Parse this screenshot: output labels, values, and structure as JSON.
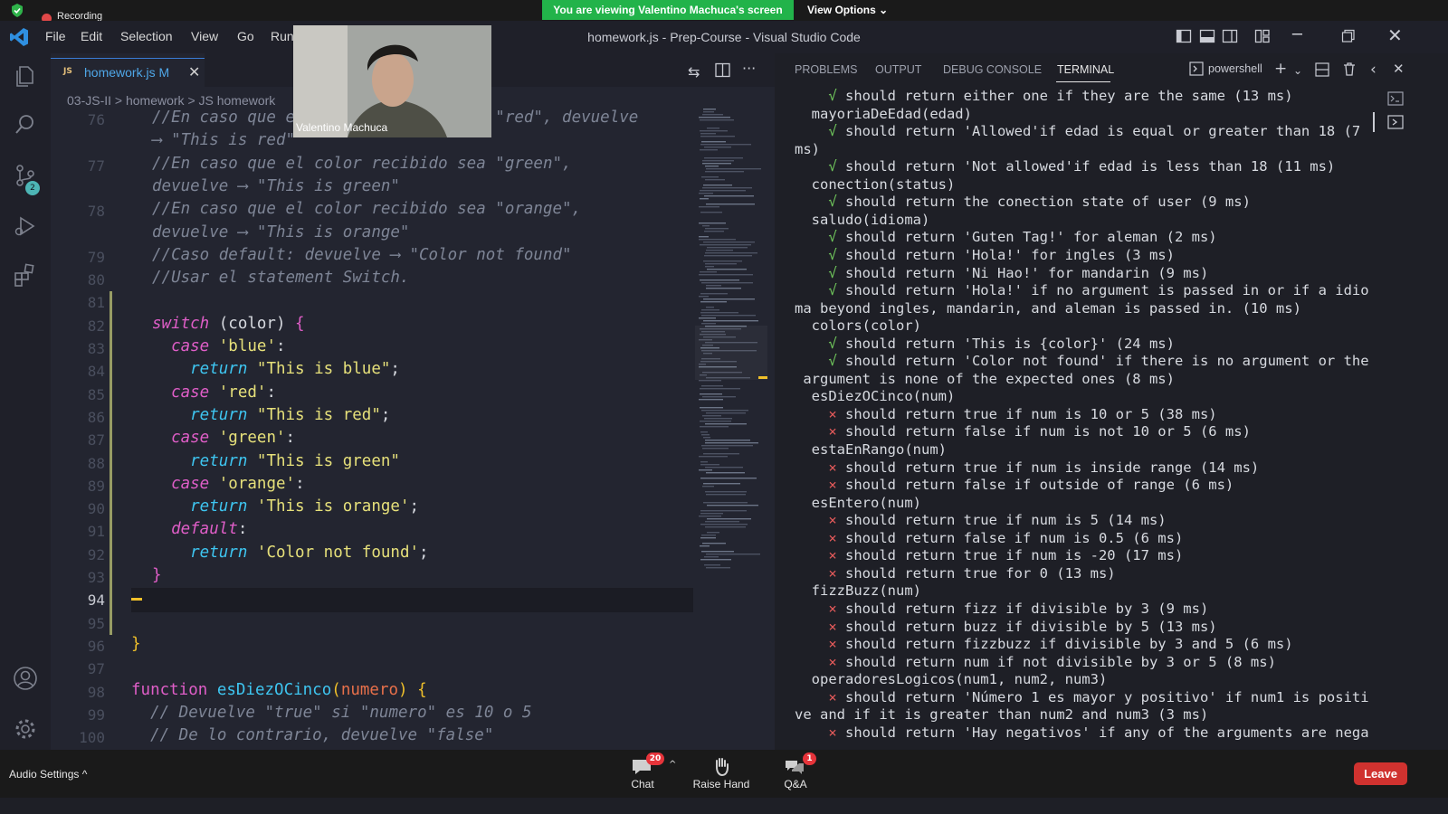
{
  "zoom": {
    "recording_label": "Recording",
    "viewing_banner": "You are viewing Valentino Machuca's screen",
    "view_options": "View Options ⌄",
    "webcam_name": "Valentino Machuca",
    "audio_settings": "Audio Settings ^",
    "chat_label": "Chat",
    "chat_badge": "20",
    "raise_hand_label": "Raise Hand",
    "qa_label": "Q&A",
    "qa_badge": "1",
    "leave_label": "Leave"
  },
  "vscode": {
    "menu": [
      "File",
      "Edit",
      "Selection",
      "View",
      "Go",
      "Run"
    ],
    "window_title": "homework.js - Prep-Course - Visual Studio Code",
    "tab_label": "homework.js M",
    "tab_file_icon": "JS",
    "breadcrumb": "03-JS-II  >  homework  >  JS  homework",
    "git_badge": "2",
    "code_lines": [
      {
        "n": "76",
        "segs": [
          {
            "t": "//En caso que el color recibido sea \"red\", devuelve",
            "c": "#7e8596",
            "i": true
          }
        ]
      },
      {
        "n": "",
        "segs": [
          {
            "t": "⟶ \"This is red\"",
            "c": "#7e8596",
            "i": true
          }
        ]
      },
      {
        "n": "77",
        "segs": [
          {
            "t": "//En caso que el color recibido sea \"green\",",
            "c": "#7e8596",
            "i": true
          }
        ]
      },
      {
        "n": "",
        "segs": [
          {
            "t": "devuelve ⟶ \"This is green\"",
            "c": "#7e8596",
            "i": true
          }
        ]
      },
      {
        "n": "78",
        "segs": [
          {
            "t": "//En caso que el color recibido sea \"orange\",",
            "c": "#7e8596",
            "i": true
          }
        ]
      },
      {
        "n": "",
        "segs": [
          {
            "t": "devuelve ⟶ \"This is orange\"",
            "c": "#7e8596",
            "i": true
          }
        ]
      },
      {
        "n": "79",
        "segs": [
          {
            "t": "//Caso default: devuelve ⟶ \"Color not found\"",
            "c": "#7e8596",
            "i": true
          }
        ]
      },
      {
        "n": "80",
        "segs": [
          {
            "t": "//Usar el statement Switch.",
            "c": "#7e8596",
            "i": true
          }
        ]
      },
      {
        "n": "81",
        "segs": []
      },
      {
        "n": "82",
        "segs": [
          {
            "t": "switch",
            "c": "#e05ec8",
            "i": true
          },
          {
            "t": " (color) ",
            "c": "#d7dae0"
          },
          {
            "t": "{",
            "c": "#e05ec8"
          }
        ]
      },
      {
        "n": "83",
        "segs": [
          {
            "t": "  case ",
            "c": "#e05ec8",
            "i": true
          },
          {
            "t": "'blue'",
            "c": "#e6e07a"
          },
          {
            "t": ":",
            "c": "#d7dae0"
          }
        ]
      },
      {
        "n": "84",
        "segs": [
          {
            "t": "    return ",
            "c": "#3ec5f0",
            "i": true
          },
          {
            "t": "\"This is blue\"",
            "c": "#e6e07a"
          },
          {
            "t": ";",
            "c": "#d7dae0"
          }
        ]
      },
      {
        "n": "85",
        "segs": [
          {
            "t": "  case ",
            "c": "#e05ec8",
            "i": true
          },
          {
            "t": "'red'",
            "c": "#e6e07a"
          },
          {
            "t": ":",
            "c": "#d7dae0"
          }
        ]
      },
      {
        "n": "86",
        "segs": [
          {
            "t": "    return ",
            "c": "#3ec5f0",
            "i": true
          },
          {
            "t": "\"This is red\"",
            "c": "#e6e07a"
          },
          {
            "t": ";",
            "c": "#d7dae0"
          }
        ]
      },
      {
        "n": "87",
        "segs": [
          {
            "t": "  case ",
            "c": "#e05ec8",
            "i": true
          },
          {
            "t": "'green'",
            "c": "#e6e07a"
          },
          {
            "t": ":",
            "c": "#d7dae0"
          }
        ]
      },
      {
        "n": "88",
        "segs": [
          {
            "t": "    return ",
            "c": "#3ec5f0",
            "i": true
          },
          {
            "t": "\"This is green\"",
            "c": "#e6e07a"
          }
        ]
      },
      {
        "n": "89",
        "segs": [
          {
            "t": "  case ",
            "c": "#e05ec8",
            "i": true
          },
          {
            "t": "'orange'",
            "c": "#e6e07a"
          },
          {
            "t": ":",
            "c": "#d7dae0"
          }
        ]
      },
      {
        "n": "90",
        "segs": [
          {
            "t": "    return ",
            "c": "#3ec5f0",
            "i": true
          },
          {
            "t": "'This is orange'",
            "c": "#e6e07a"
          },
          {
            "t": ";",
            "c": "#d7dae0"
          }
        ]
      },
      {
        "n": "91",
        "segs": [
          {
            "t": "  default",
            "c": "#e05ec8",
            "i": true
          },
          {
            "t": ":",
            "c": "#d7dae0"
          }
        ]
      },
      {
        "n": "92",
        "segs": [
          {
            "t": "    return ",
            "c": "#3ec5f0",
            "i": true
          },
          {
            "t": "'Color not found'",
            "c": "#e6e07a"
          },
          {
            "t": ";",
            "c": "#d7dae0"
          }
        ]
      },
      {
        "n": "93",
        "segs": [
          {
            "t": "}",
            "c": "#e05ec8"
          }
        ]
      },
      {
        "n": "94",
        "segs": [],
        "current": true
      },
      {
        "n": "95",
        "segs": []
      },
      {
        "n": "96",
        "segs": [
          {
            "t": "}",
            "c": "#f0c02a"
          }
        ],
        "outer": true
      },
      {
        "n": "97",
        "segs": []
      },
      {
        "n": "98",
        "segs": [
          {
            "t": "function ",
            "c": "#e05ec8"
          },
          {
            "t": "esDiezOCinco",
            "c": "#3ec5f0"
          },
          {
            "t": "(",
            "c": "#f0c02a"
          },
          {
            "t": "numero",
            "c": "#e8704a"
          },
          {
            "t": ") {",
            "c": "#f0c02a"
          }
        ],
        "outer": true
      },
      {
        "n": "99",
        "segs": [
          {
            "t": "  // Devuelve \"true\" si \"numero\" es 10 o 5",
            "c": "#7e8596",
            "i": true
          }
        ],
        "outer": true
      },
      {
        "n": "100",
        "segs": [
          {
            "t": "  // De lo contrario, devuelve \"false\"",
            "c": "#7e8596",
            "i": true
          }
        ],
        "outer": true
      }
    ],
    "panel_tabs": [
      "PROBLEMS",
      "OUTPUT",
      "DEBUG CONSOLE",
      "TERMINAL"
    ],
    "shell_label": "powershell",
    "terminal_lines": [
      {
        "ind": "    ",
        "m": "√",
        "k": "ok",
        "t": " should return either one if they are the same (13 ms)"
      },
      {
        "ind": "  ",
        "m": "",
        "k": "",
        "t": "mayoriaDeEdad(edad)"
      },
      {
        "ind": "    ",
        "m": "√",
        "k": "ok",
        "t": " should return 'Allowed'if edad is equal or greater than 18 (7"
      },
      {
        "ind": "",
        "m": "",
        "k": "",
        "t": "ms)"
      },
      {
        "ind": "    ",
        "m": "√",
        "k": "ok",
        "t": " should return 'Not allowed'if edad is less than 18 (11 ms)"
      },
      {
        "ind": "  ",
        "m": "",
        "k": "",
        "t": "conection(status)"
      },
      {
        "ind": "    ",
        "m": "√",
        "k": "ok",
        "t": " should return the conection state of user (9 ms)"
      },
      {
        "ind": "  ",
        "m": "",
        "k": "",
        "t": "saludo(idioma)"
      },
      {
        "ind": "    ",
        "m": "√",
        "k": "ok",
        "t": " should return 'Guten Tag!' for aleman (2 ms)"
      },
      {
        "ind": "    ",
        "m": "√",
        "k": "ok",
        "t": " should return 'Hola!' for ingles (3 ms)"
      },
      {
        "ind": "    ",
        "m": "√",
        "k": "ok",
        "t": " should return 'Ni Hao!' for mandarin (9 ms)"
      },
      {
        "ind": "    ",
        "m": "√",
        "k": "ok",
        "t": " should return 'Hola!' if no argument is passed in or if a idio"
      },
      {
        "ind": "",
        "m": "",
        "k": "",
        "t": "ma beyond ingles, mandarin, and aleman is passed in. (10 ms)"
      },
      {
        "ind": "  ",
        "m": "",
        "k": "",
        "t": "colors(color)"
      },
      {
        "ind": "    ",
        "m": "√",
        "k": "ok",
        "t": " should return 'This is {color}' (24 ms)"
      },
      {
        "ind": "    ",
        "m": "√",
        "k": "ok",
        "t": " should return 'Color not found' if there is no argument or the"
      },
      {
        "ind": " ",
        "m": "",
        "k": "",
        "t": "argument is none of the expected ones (8 ms)"
      },
      {
        "ind": "  ",
        "m": "",
        "k": "",
        "t": "esDiezOCinco(num)"
      },
      {
        "ind": "    ",
        "m": "×",
        "k": "fail",
        "t": " should return true if num is 10 or 5 (38 ms)"
      },
      {
        "ind": "    ",
        "m": "×",
        "k": "fail",
        "t": " should return false if num is not 10 or 5 (6 ms)"
      },
      {
        "ind": "  ",
        "m": "",
        "k": "",
        "t": "estaEnRango(num)"
      },
      {
        "ind": "    ",
        "m": "×",
        "k": "fail",
        "t": " should return true if num is inside range (14 ms)"
      },
      {
        "ind": "    ",
        "m": "×",
        "k": "fail",
        "t": " should return false if outside of range (6 ms)"
      },
      {
        "ind": "  ",
        "m": "",
        "k": "",
        "t": "esEntero(num)"
      },
      {
        "ind": "    ",
        "m": "×",
        "k": "fail",
        "t": " should return true if num is 5 (14 ms)"
      },
      {
        "ind": "    ",
        "m": "×",
        "k": "fail",
        "t": " should return false if num is 0.5 (6 ms)"
      },
      {
        "ind": "    ",
        "m": "×",
        "k": "fail",
        "t": " should return true if num is -20 (17 ms)"
      },
      {
        "ind": "    ",
        "m": "×",
        "k": "fail",
        "t": " should return true for 0 (13 ms)"
      },
      {
        "ind": "  ",
        "m": "",
        "k": "",
        "t": "fizzBuzz(num)"
      },
      {
        "ind": "    ",
        "m": "×",
        "k": "fail",
        "t": " should return fizz if divisible by 3 (9 ms)"
      },
      {
        "ind": "    ",
        "m": "×",
        "k": "fail",
        "t": " should return buzz if divisible by 5 (13 ms)"
      },
      {
        "ind": "    ",
        "m": "×",
        "k": "fail",
        "t": " should return fizzbuzz if divisible by 3 and 5 (6 ms)"
      },
      {
        "ind": "    ",
        "m": "×",
        "k": "fail",
        "t": " should return num if not divisible by 3 or 5 (8 ms)"
      },
      {
        "ind": "  ",
        "m": "",
        "k": "",
        "t": "operadoresLogicos(num1, num2, num3)"
      },
      {
        "ind": "    ",
        "m": "×",
        "k": "fail",
        "t": " should return 'Número 1 es mayor y positivo' if num1 is positi"
      },
      {
        "ind": "",
        "m": "",
        "k": "",
        "t": "ve and if it is greater than num2 and num3 (3 ms)"
      },
      {
        "ind": "    ",
        "m": "×",
        "k": "fail",
        "t": " should return 'Hay negativos' if any of the arguments are nega"
      }
    ]
  }
}
